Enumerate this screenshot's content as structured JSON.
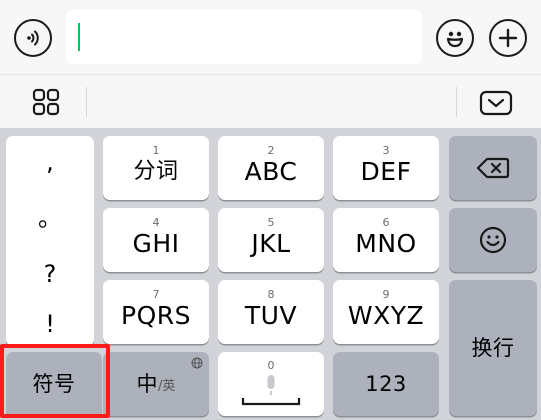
{
  "input_bar": {
    "text_value": ""
  },
  "punctuation": [
    ",",
    "。",
    "?",
    "!"
  ],
  "keys": {
    "row1": [
      {
        "num": "1",
        "label": "分词"
      },
      {
        "num": "2",
        "label": "ABC"
      },
      {
        "num": "3",
        "label": "DEF"
      }
    ],
    "row2": [
      {
        "num": "4",
        "label": "GHI"
      },
      {
        "num": "5",
        "label": "JKL"
      },
      {
        "num": "6",
        "label": "MNO"
      }
    ],
    "row3": [
      {
        "num": "7",
        "label": "PQRS"
      },
      {
        "num": "8",
        "label": "TUV"
      },
      {
        "num": "9",
        "label": "WXYZ"
      }
    ],
    "bottom": {
      "symbol_label": "符号",
      "lang_main": "中",
      "lang_sub": "/英",
      "space_num": "0",
      "numbers_label": "123"
    },
    "enter_label": "换行"
  },
  "icons": {
    "voice": "voice-icon",
    "emoji": "emoji-icon",
    "plus": "plus-icon",
    "grid": "grid-icon",
    "collapse": "keyboard-collapse-icon",
    "backspace": "backspace-icon",
    "smiley": "smiley-key-icon",
    "mic": "mic-icon",
    "globe": "globe-icon"
  },
  "colors": {
    "caret": "#07c160",
    "highlight": "#ff1a1a",
    "dark_key": "#acb1bc",
    "keyboard_bg": "#d1d3d9"
  }
}
